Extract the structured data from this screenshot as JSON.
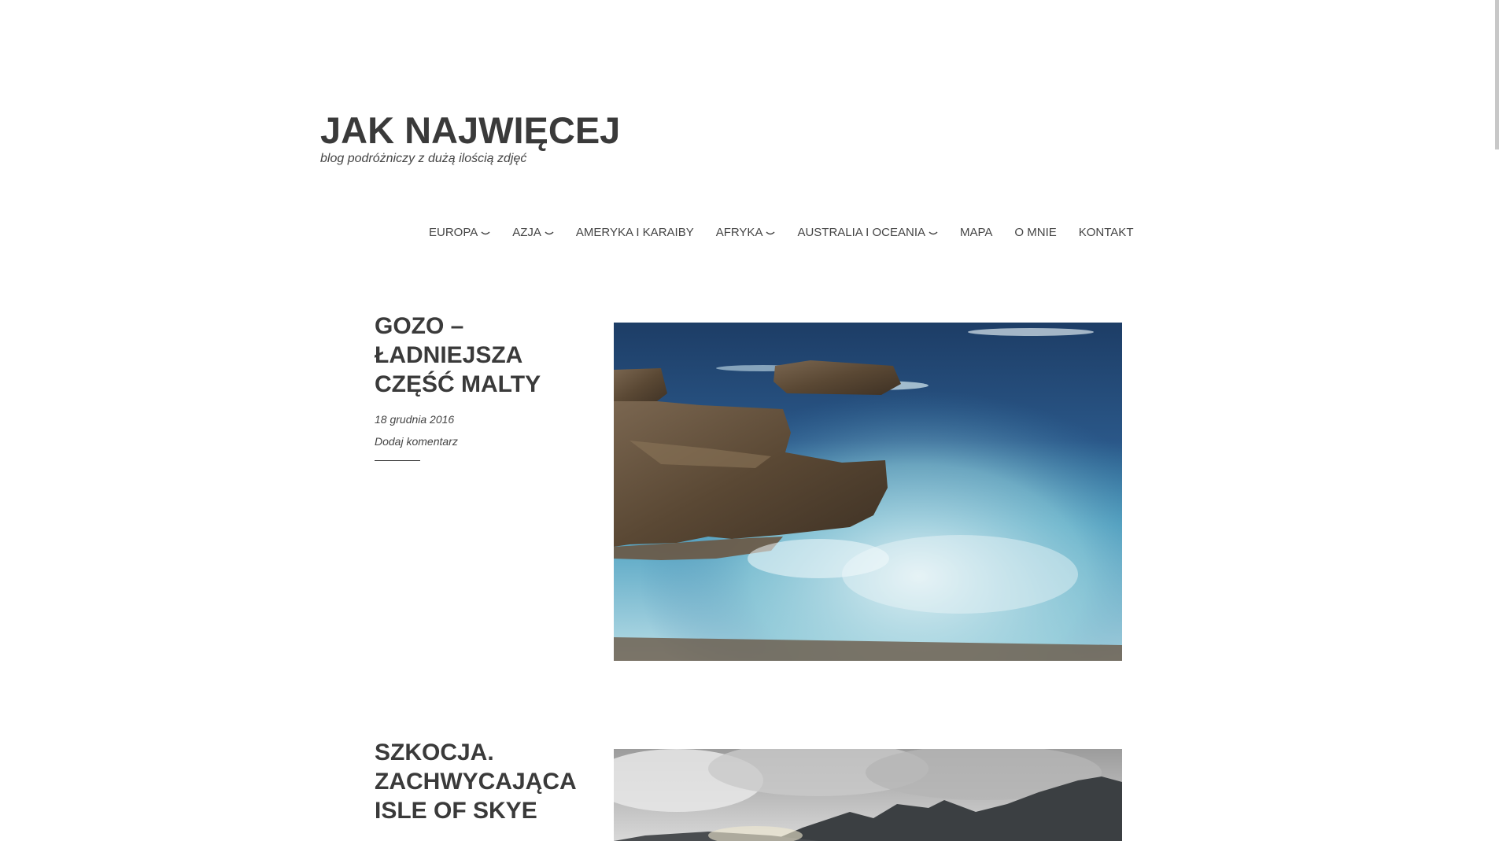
{
  "header": {
    "title": "JAK NAJWIĘCEJ",
    "description": "blog podróżniczy z dużą ilością zdjęć"
  },
  "nav": {
    "items": [
      {
        "label": "EUROPA",
        "has_submenu": true
      },
      {
        "label": "AZJA",
        "has_submenu": true
      },
      {
        "label": "AMERYKA I KARAIBY",
        "has_submenu": false
      },
      {
        "label": "AFRYKA",
        "has_submenu": true
      },
      {
        "label": "AUSTRALIA I OCEANIA",
        "has_submenu": true
      },
      {
        "label": "MAPA",
        "has_submenu": false
      },
      {
        "label": "O MNIE",
        "has_submenu": false
      },
      {
        "label": "KONTAKT",
        "has_submenu": false
      }
    ]
  },
  "posts": [
    {
      "title": "GOZO – ŁADNIEJSZA CZĘŚĆ MALTY",
      "date": "18 grudnia 2016",
      "comments": "Dodaj komentarz",
      "image": "rocky-coast-sea-photo"
    },
    {
      "title": "SZKOCJA. ZACHWYCAJĄCA ISLE OF SKYE",
      "image": "mountains-clouds-photo"
    }
  ]
}
